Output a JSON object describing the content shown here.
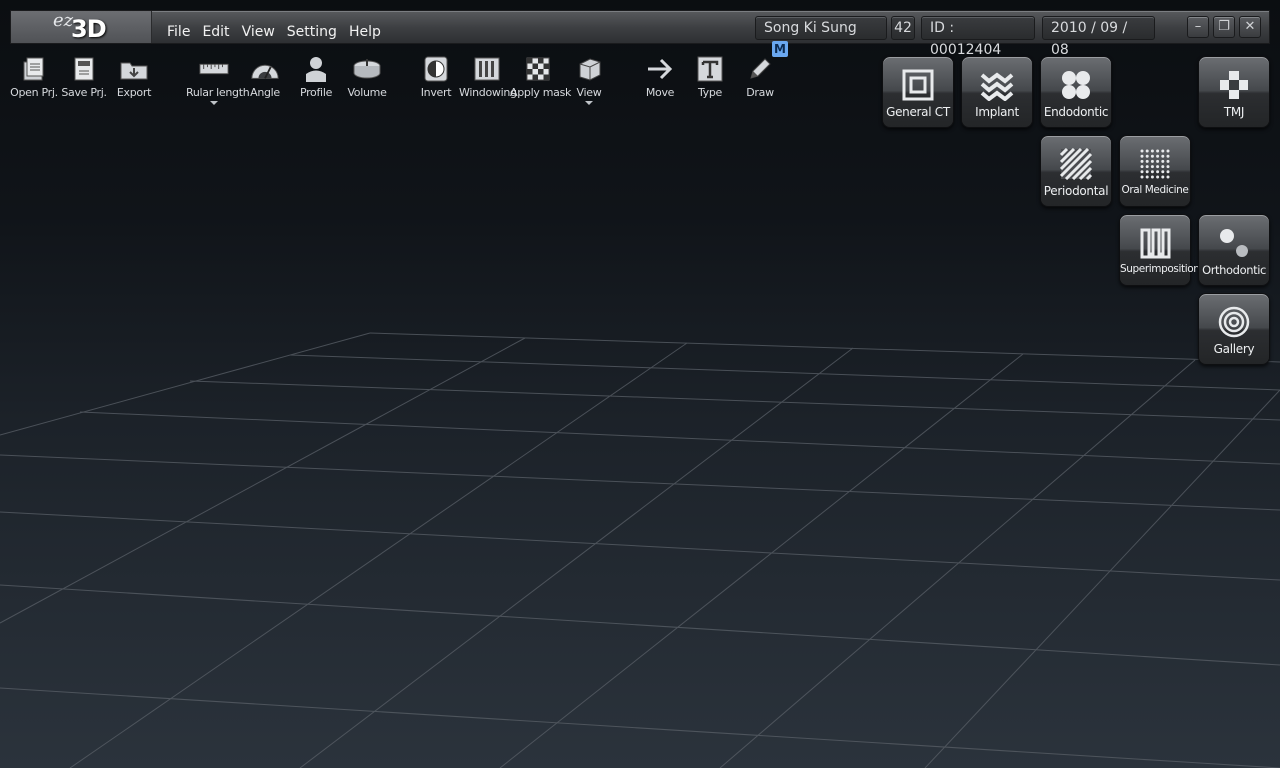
{
  "app": {
    "logo_ez": "ez",
    "logo_3d": "3D"
  },
  "menu": [
    "File",
    "Edit",
    "View",
    "Setting",
    "Help"
  ],
  "status": {
    "user": "Song Ki Sung",
    "gender_badge": "M",
    "age": "42",
    "patient_id": "ID : 00012404",
    "date": "2010 / 09 / 08"
  },
  "window_controls": {
    "minimize": "–",
    "restore": "❐",
    "close": "✕"
  },
  "toolbar": {
    "open": "Open Prj.",
    "save": "Save Prj.",
    "export": "Export",
    "ruler": "Rular length",
    "angle": "Angle",
    "profile": "Profile",
    "volume": "Volume",
    "invert": "Invert",
    "windowing": "Windowing",
    "apply_mask": "Apply mask",
    "view": "View",
    "move": "Move",
    "type": "Type",
    "draw": "Draw"
  },
  "modules": {
    "general_ct": "General CT",
    "implant": "Implant",
    "endodontic": "Endodontic",
    "tmj": "TMJ",
    "periodontal": "Periodontal",
    "oral_medicine": "Oral Medicine",
    "superimposition": "Superimposition",
    "orthodontic": "Orthodontic",
    "gallery": "Gallery"
  },
  "icons": {
    "accent_badge": "#6aa8f0",
    "names": [
      "open-project-icon",
      "save-project-icon",
      "export-icon",
      "ruler-icon",
      "angle-icon",
      "profile-icon",
      "volume-icon",
      "invert-icon",
      "windowing-icon",
      "apply-mask-icon",
      "view-cube-icon",
      "move-arrow-icon",
      "type-t-icon",
      "draw-pencil-icon"
    ]
  }
}
